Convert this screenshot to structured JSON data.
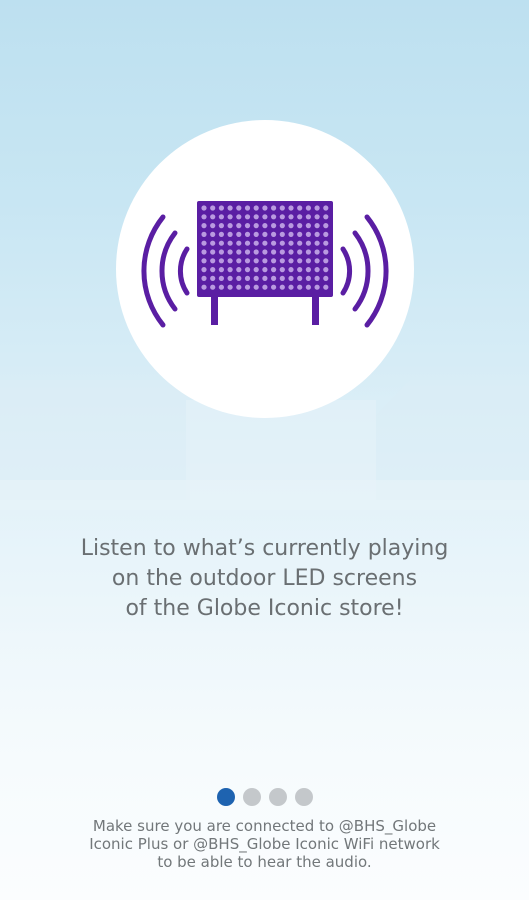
{
  "onboarding": {
    "illustration": "outdoor-led-screen-with-sound-waves-icon",
    "headline": [
      "Listen to what’s currently playing",
      "on the outdoor LED screens",
      "of the Globe Iconic store!"
    ],
    "pager": {
      "total": 4,
      "current": 1
    },
    "note": [
      "Make sure you are connected to @BHS_Globe",
      "Iconic Plus or @BHS_Globe Iconic WiFi network",
      "to be able to hear the audio."
    ]
  },
  "colors": {
    "icon": "#5a1ea3",
    "active_dot": "#1e63b0",
    "inactive_dot": "#c4c8cb",
    "text": "#6a6f72"
  }
}
